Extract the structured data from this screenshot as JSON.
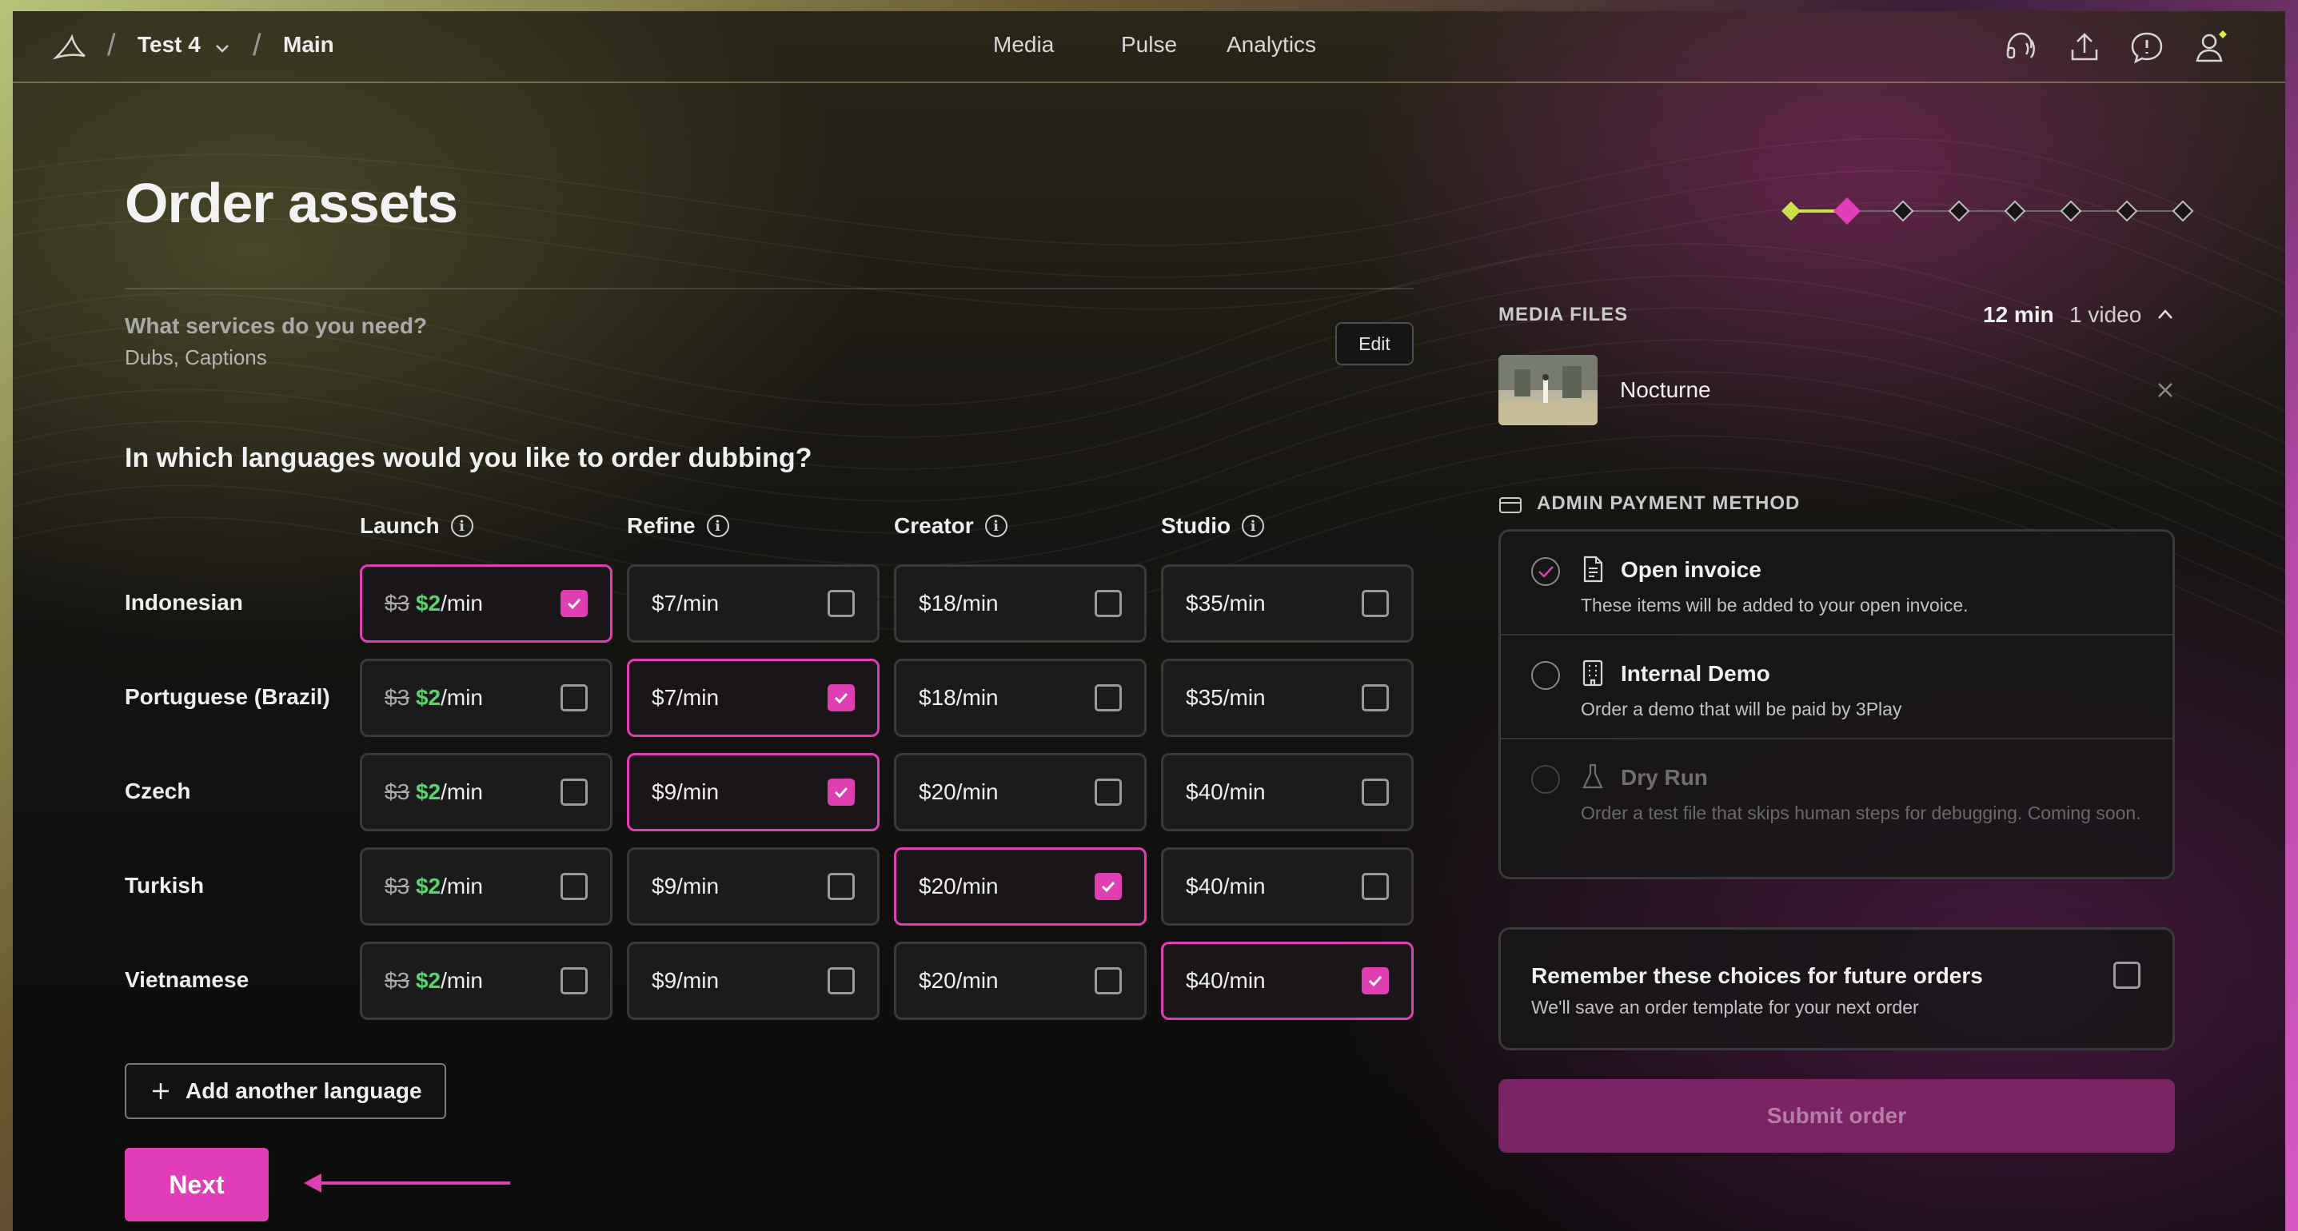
{
  "breadcrumb": {
    "project": "Test 4",
    "page": "Main"
  },
  "nav": {
    "media": "Media",
    "pulse": "Pulse",
    "analytics": "Analytics"
  },
  "header": {
    "title": "Order assets"
  },
  "stepper": {
    "total_steps": 8,
    "current_step": 2
  },
  "services": {
    "question": "What services do you need?",
    "answer": "Dubs, Captions",
    "edit_label": "Edit"
  },
  "dubbing": {
    "question": "In which languages would you like to order dubbing?",
    "columns": [
      "Launch",
      "Refine",
      "Creator",
      "Studio"
    ],
    "rows": [
      {
        "language": "Indonesian",
        "launch_old": "$3",
        "launch_new": "$2",
        "unit": "/min",
        "prices": [
          "$7/min",
          "$18/min",
          "$35/min"
        ],
        "selected": 0
      },
      {
        "language": "Portuguese (Brazil)",
        "launch_old": "$3",
        "launch_new": "$2",
        "unit": "/min",
        "prices": [
          "$7/min",
          "$18/min",
          "$35/min"
        ],
        "selected": 1
      },
      {
        "language": "Czech",
        "launch_old": "$3",
        "launch_new": "$2",
        "unit": "/min",
        "prices": [
          "$9/min",
          "$20/min",
          "$40/min"
        ],
        "selected": 1
      },
      {
        "language": "Turkish",
        "launch_old": "$3",
        "launch_new": "$2",
        "unit": "/min",
        "prices": [
          "$9/min",
          "$20/min",
          "$40/min"
        ],
        "selected": 2
      },
      {
        "language": "Vietnamese",
        "launch_old": "$3",
        "launch_new": "$2",
        "unit": "/min",
        "prices": [
          "$9/min",
          "$20/min",
          "$40/min"
        ],
        "selected": 3
      }
    ],
    "add_language_label": "Add another language",
    "next_label": "Next"
  },
  "media_files": {
    "label": "MEDIA FILES",
    "duration": "12 min",
    "count": "1 video",
    "items": [
      {
        "name": "Nocturne"
      }
    ]
  },
  "payment": {
    "label": "ADMIN PAYMENT METHOD",
    "options": [
      {
        "title": "Open invoice",
        "desc": "These items will be added to your open invoice.",
        "selected": true,
        "disabled": false
      },
      {
        "title": "Internal Demo",
        "desc": "Order a demo that will be paid by 3Play",
        "selected": false,
        "disabled": false
      },
      {
        "title": "Dry Run",
        "desc": "Order a test file that skips human steps for debugging. Coming soon.",
        "selected": false,
        "disabled": true
      }
    ]
  },
  "remember": {
    "title": "Remember these choices for future orders",
    "desc": "We'll save an order template for your next order"
  },
  "submit_label": "Submit order",
  "colors": {
    "accent": "#e23db9",
    "accent_dark": "#7a2466",
    "success": "#55d86a",
    "step_done": "#c8e04a"
  }
}
